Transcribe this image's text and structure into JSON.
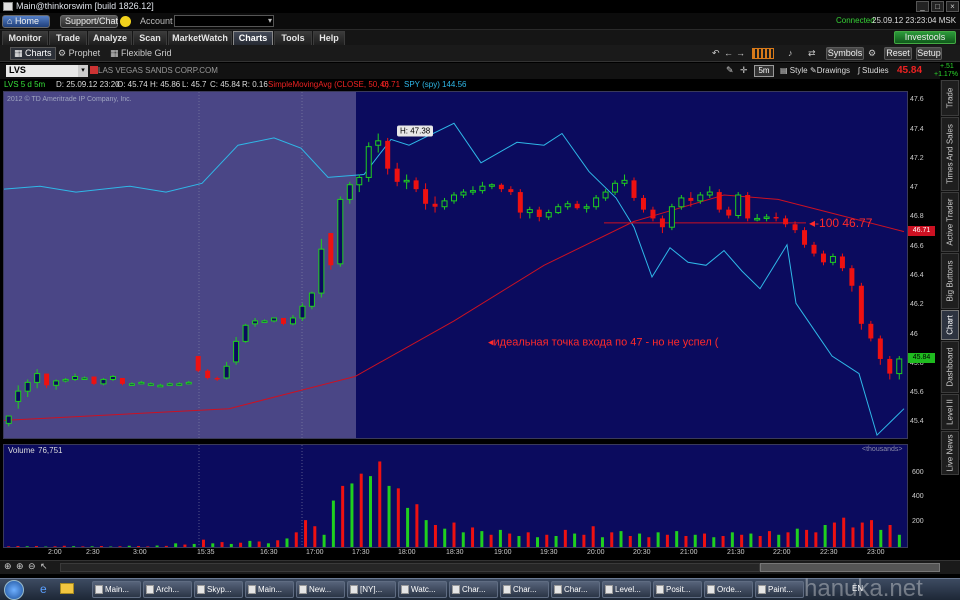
{
  "window": {
    "title": "Main@thinkorswim [build 1826.12]"
  },
  "account_bar": {
    "home": "Home",
    "support": "Support/Chat",
    "account_label": "Account",
    "connected": "Connected",
    "datetime": "25.09.12 23:23:04 MSK"
  },
  "main_tabs": [
    "Monitor",
    "Trade",
    "Analyze",
    "Scan",
    "MarketWatch",
    "Charts",
    "Tools",
    "Help"
  ],
  "active_tab": "Charts",
  "investools": "Investools",
  "subtabs": [
    "Charts",
    "Prophet",
    "Flexible Grid"
  ],
  "toolbar": {
    "symbols": "Symbols",
    "reset": "Reset",
    "setup": "Setup"
  },
  "symbol_bar": {
    "symbol": "LVS",
    "company": "LAS VEGAS SANDS CORP.COM",
    "period": "5m",
    "style": "Style",
    "drawings": "Drawings",
    "studies": "Studies",
    "last": "45.84",
    "change": "+.51",
    "change_pct": "+1.17%"
  },
  "info": {
    "symbol_period": "LVS 5 d 5m",
    "date": "D: 25.09.12 23:20",
    "open": "O: 45.74",
    "high": "H: 45.86",
    "low": "L: 45.7",
    "close": "C: 45.84",
    "range": "R: 0.16",
    "study": "SimpleMovingAvg (CLOSE, 50, 0)",
    "study_value": "46.71",
    "compare": "SPY (spy)",
    "compare_value": "144.56"
  },
  "copyright": "2012 © TD Ameritrade IP Company, Inc.",
  "annotations": {
    "high": "H: 47.38",
    "level": "-100 46.77",
    "entry": "идеальная точка входа по 47 - но не успел ("
  },
  "y_ticks": [
    "47.6",
    "47.4",
    "47.2",
    "47",
    "46.8",
    "46.6",
    "46.4",
    "46.2",
    "46",
    "45.8",
    "45.6",
    "45.4"
  ],
  "price_badges": {
    "sma": "46.71",
    "last": "45.84"
  },
  "volume": {
    "label": "Volume",
    "value": "76,751",
    "unit": "<thousands>",
    "ticks": [
      "600",
      "400",
      "200"
    ]
  },
  "x_ticks": [
    "2:00",
    "2:30",
    "3:00",
    "15:35",
    "16:30",
    "17:00",
    "17:30",
    "18:00",
    "18:30",
    "19:00",
    "19:30",
    "20:00",
    "20:30",
    "21:00",
    "21:30",
    "22:00",
    "22:30",
    "23:00"
  ],
  "side_tabs": [
    "Trade",
    "Times And Sales",
    "Active Trader",
    "Big Buttons",
    "Chart",
    "Dashboard",
    "Level II",
    "Live News"
  ],
  "active_side_tab": "Chart",
  "taskbar": {
    "items": [
      "Main...",
      "Arch...",
      "Skyp...",
      "Main...",
      "New...",
      "[NY]...",
      "Watc...",
      "Char...",
      "Char...",
      "Char...",
      "Level...",
      "Posit...",
      "Orde...",
      "Paint..."
    ],
    "lang": "EN",
    "watermark": "hanuka.net"
  },
  "colors": {
    "up": "#1fcf1f",
    "down": "#ee1111",
    "sma": "#cc1122",
    "spy": "#2fb8e8",
    "bg": "#0b0b5e",
    "premarket": "#4a4686",
    "annotation": "#ff2a2a"
  },
  "chart_data": {
    "type": "candlestick",
    "symbol": "LVS",
    "interval": "5m",
    "ylim": [
      45.3,
      47.65
    ],
    "x_tick_labels": [
      "2:00",
      "2:30",
      "3:00",
      "15:35",
      "16:30",
      "17:00",
      "17:30",
      "18:00",
      "18:30",
      "19:00",
      "19:30",
      "20:00",
      "20:30",
      "21:00",
      "21:30",
      "22:00",
      "22:30",
      "23:00"
    ],
    "candles": [
      [
        45.4,
        45.45,
        45.38,
        45.45,
        0
      ],
      [
        45.55,
        45.66,
        45.5,
        45.62,
        0
      ],
      [
        45.62,
        45.7,
        45.58,
        45.68,
        0
      ],
      [
        45.68,
        45.77,
        45.64,
        45.74,
        0
      ],
      [
        45.74,
        45.74,
        45.64,
        45.66,
        0
      ],
      [
        45.66,
        45.7,
        45.63,
        45.69,
        0
      ],
      [
        45.69,
        45.71,
        45.68,
        45.7,
        0
      ],
      [
        45.7,
        45.74,
        45.69,
        45.72,
        0
      ],
      [
        45.71,
        45.72,
        45.7,
        45.71,
        0
      ],
      [
        45.72,
        45.72,
        45.66,
        45.67,
        0
      ],
      [
        45.67,
        45.71,
        45.66,
        45.7,
        0
      ],
      [
        45.7,
        45.73,
        45.69,
        45.72,
        0
      ],
      [
        45.71,
        45.71,
        45.66,
        45.67,
        0
      ],
      [
        45.67,
        45.68,
        45.66,
        45.67,
        0
      ],
      [
        45.68,
        45.69,
        45.67,
        45.68,
        0
      ],
      [
        45.67,
        45.68,
        45.66,
        45.67,
        0
      ],
      [
        45.66,
        45.67,
        45.65,
        45.66,
        0
      ],
      [
        45.67,
        45.68,
        45.66,
        45.67,
        0
      ],
      [
        45.67,
        45.68,
        45.66,
        45.67,
        0
      ],
      [
        45.68,
        45.69,
        45.67,
        45.68,
        0
      ],
      [
        45.86,
        45.86,
        45.75,
        45.76,
        0
      ],
      [
        45.76,
        45.77,
        45.7,
        45.71,
        0
      ],
      [
        45.71,
        45.72,
        45.69,
        45.7,
        0
      ],
      [
        45.71,
        45.82,
        45.7,
        45.79,
        0
      ],
      [
        45.82,
        45.99,
        45.8,
        45.96,
        0
      ],
      [
        45.96,
        46.08,
        45.95,
        46.07,
        0
      ],
      [
        46.08,
        46.12,
        46.06,
        46.1,
        0
      ],
      [
        46.1,
        46.11,
        46.09,
        46.1,
        0
      ],
      [
        46.1,
        46.12,
        46.09,
        46.12,
        0
      ],
      [
        46.12,
        46.12,
        46.07,
        46.08,
        0
      ],
      [
        46.08,
        46.14,
        46.07,
        46.12,
        0
      ],
      [
        46.12,
        46.22,
        46.1,
        46.2,
        0
      ],
      [
        46.2,
        46.3,
        46.18,
        46.29,
        0
      ],
      [
        46.29,
        46.66,
        46.26,
        46.59,
        0
      ],
      [
        46.7,
        46.7,
        46.45,
        46.48,
        0
      ],
      [
        46.49,
        46.95,
        46.47,
        46.93,
        0
      ],
      [
        46.93,
        47.05,
        46.9,
        47.03,
        0
      ],
      [
        47.03,
        47.1,
        46.98,
        47.08,
        0
      ],
      [
        47.08,
        47.32,
        47.05,
        47.29,
        0
      ],
      [
        47.3,
        47.38,
        47.25,
        47.33,
        0
      ],
      [
        47.33,
        47.35,
        47.1,
        47.14,
        0
      ],
      [
        47.14,
        47.18,
        47.02,
        47.05,
        0
      ],
      [
        47.05,
        47.1,
        47.0,
        47.06,
        0
      ],
      [
        47.06,
        47.08,
        46.98,
        47.0,
        0
      ],
      [
        47.0,
        47.04,
        46.86,
        46.9,
        0
      ],
      [
        46.9,
        46.95,
        46.84,
        46.88,
        0
      ],
      [
        46.88,
        46.94,
        46.86,
        46.92,
        0
      ],
      [
        46.92,
        46.98,
        46.9,
        46.96,
        0
      ],
      [
        46.96,
        47.0,
        46.94,
        46.98,
        0
      ],
      [
        46.98,
        47.02,
        46.96,
        46.99,
        0
      ],
      [
        46.99,
        47.05,
        46.97,
        47.02,
        0
      ],
      [
        47.02,
        47.04,
        47.0,
        47.03,
        0
      ],
      [
        47.03,
        47.04,
        46.98,
        47.0,
        0
      ],
      [
        47.0,
        47.02,
        46.96,
        46.98,
        0
      ],
      [
        46.98,
        47.0,
        46.8,
        46.84,
        0
      ],
      [
        46.84,
        46.88,
        46.8,
        46.86,
        0
      ],
      [
        46.86,
        46.88,
        46.78,
        46.81,
        0
      ],
      [
        46.81,
        46.86,
        46.79,
        46.84,
        0
      ],
      [
        46.84,
        46.9,
        46.83,
        46.88,
        0
      ],
      [
        46.88,
        46.92,
        46.86,
        46.9,
        0
      ],
      [
        46.9,
        46.92,
        46.86,
        46.87,
        0
      ],
      [
        46.87,
        46.9,
        46.84,
        46.88,
        0
      ],
      [
        46.88,
        46.96,
        46.86,
        46.94,
        0
      ],
      [
        46.94,
        47.0,
        46.92,
        46.98,
        0
      ],
      [
        46.98,
        47.06,
        46.96,
        47.04,
        0
      ],
      [
        47.04,
        47.1,
        47.02,
        47.06,
        0
      ],
      [
        47.06,
        47.08,
        46.92,
        46.94,
        0
      ],
      [
        46.94,
        46.96,
        46.84,
        46.86,
        0
      ],
      [
        46.86,
        46.88,
        46.78,
        46.8,
        0
      ],
      [
        46.8,
        46.82,
        46.7,
        46.74,
        0
      ],
      [
        46.74,
        46.9,
        46.72,
        46.88,
        0
      ],
      [
        46.88,
        46.96,
        46.86,
        46.94,
        0
      ],
      [
        46.94,
        46.98,
        46.88,
        46.92,
        0
      ],
      [
        46.92,
        46.98,
        46.9,
        46.96,
        0
      ],
      [
        46.96,
        47.02,
        46.94,
        46.98,
        0
      ],
      [
        46.98,
        47.0,
        46.84,
        46.86,
        0
      ],
      [
        46.86,
        46.88,
        46.8,
        46.82,
        0
      ],
      [
        46.82,
        46.98,
        46.8,
        46.96,
        0
      ],
      [
        46.96,
        46.98,
        46.78,
        46.8,
        0
      ],
      [
        46.8,
        46.83,
        46.78,
        46.8,
        0
      ],
      [
        46.8,
        46.83,
        46.78,
        46.81,
        0
      ],
      [
        46.81,
        46.84,
        46.78,
        46.8,
        0
      ],
      [
        46.8,
        46.82,
        46.74,
        46.76,
        0
      ],
      [
        46.76,
        46.78,
        46.7,
        46.72,
        0
      ],
      [
        46.72,
        46.74,
        46.6,
        46.62,
        0
      ],
      [
        46.62,
        46.64,
        46.54,
        46.56,
        0
      ],
      [
        46.56,
        46.58,
        46.48,
        46.5,
        0
      ],
      [
        46.5,
        46.56,
        46.48,
        46.54,
        0
      ],
      [
        46.54,
        46.56,
        46.44,
        46.46,
        0
      ],
      [
        46.46,
        46.48,
        46.3,
        46.34,
        0
      ],
      [
        46.34,
        46.36,
        46.04,
        46.08,
        0
      ],
      [
        46.08,
        46.1,
        45.96,
        45.98,
        0
      ],
      [
        45.98,
        46.0,
        45.8,
        45.84,
        0
      ],
      [
        45.84,
        45.86,
        45.7,
        45.74,
        0
      ],
      [
        45.74,
        45.86,
        45.7,
        45.84,
        0
      ]
    ],
    "volume_ylim": [
      0,
      720
    ],
    "volume": [
      [
        5,
        0
      ],
      [
        8,
        0
      ],
      [
        6,
        1
      ],
      [
        8,
        0
      ],
      [
        4,
        1
      ],
      [
        6,
        0
      ],
      [
        10,
        0
      ],
      [
        7,
        1
      ],
      [
        5,
        0
      ],
      [
        6,
        1
      ],
      [
        8,
        0
      ],
      [
        4,
        1
      ],
      [
        6,
        0
      ],
      [
        10,
        1
      ],
      [
        8,
        0
      ],
      [
        5,
        0
      ],
      [
        12,
        1
      ],
      [
        9,
        0
      ],
      [
        30,
        1
      ],
      [
        20,
        0
      ],
      [
        25,
        1
      ],
      [
        60,
        0
      ],
      [
        30,
        1
      ],
      [
        40,
        0
      ],
      [
        25,
        1
      ],
      [
        35,
        0
      ],
      [
        50,
        1
      ],
      [
        45,
        0
      ],
      [
        30,
        1
      ],
      [
        55,
        0
      ],
      [
        70,
        1
      ],
      [
        120,
        0
      ],
      [
        220,
        0
      ],
      [
        170,
        0
      ],
      [
        100,
        1
      ],
      [
        380,
        1
      ],
      [
        500,
        0
      ],
      [
        520,
        1
      ],
      [
        600,
        0
      ],
      [
        580,
        1
      ],
      [
        700,
        0
      ],
      [
        500,
        1
      ],
      [
        480,
        0
      ],
      [
        320,
        1
      ],
      [
        350,
        0
      ],
      [
        220,
        1
      ],
      [
        180,
        0
      ],
      [
        150,
        1
      ],
      [
        200,
        0
      ],
      [
        120,
        1
      ],
      [
        160,
        0
      ],
      [
        130,
        1
      ],
      [
        100,
        0
      ],
      [
        140,
        1
      ],
      [
        110,
        0
      ],
      [
        90,
        1
      ],
      [
        120,
        0
      ],
      [
        80,
        1
      ],
      [
        100,
        0
      ],
      [
        90,
        1
      ],
      [
        140,
        0
      ],
      [
        110,
        1
      ],
      [
        100,
        0
      ],
      [
        170,
        0
      ],
      [
        80,
        1
      ],
      [
        120,
        0
      ],
      [
        130,
        1
      ],
      [
        90,
        0
      ],
      [
        110,
        1
      ],
      [
        80,
        0
      ],
      [
        120,
        1
      ],
      [
        100,
        0
      ],
      [
        130,
        1
      ],
      [
        90,
        0
      ],
      [
        100,
        1
      ],
      [
        110,
        0
      ],
      [
        80,
        1
      ],
      [
        90,
        0
      ],
      [
        120,
        1
      ],
      [
        100,
        0
      ],
      [
        110,
        1
      ],
      [
        90,
        0
      ],
      [
        130,
        0
      ],
      [
        100,
        1
      ],
      [
        120,
        0
      ],
      [
        150,
        1
      ],
      [
        140,
        0
      ],
      [
        120,
        0
      ],
      [
        180,
        1
      ],
      [
        200,
        0
      ],
      [
        240,
        0
      ],
      [
        160,
        0
      ],
      [
        200,
        0
      ],
      [
        220,
        0
      ],
      [
        140,
        1
      ],
      [
        180,
        0
      ],
      [
        100,
        1
      ]
    ],
    "sma": [
      [
        0,
        45.42
      ],
      [
        0.25,
        45.5
      ],
      [
        0.39,
        45.72
      ],
      [
        0.5,
        46.1
      ],
      [
        0.6,
        46.48
      ],
      [
        0.7,
        46.78
      ],
      [
        0.8,
        46.96
      ],
      [
        0.86,
        46.93
      ],
      [
        0.93,
        46.82
      ],
      [
        1,
        46.71
      ]
    ],
    "spy_overlay": [
      [
        0,
        47
      ],
      [
        0.04,
        47.02
      ],
      [
        0.08,
        46.98
      ],
      [
        0.14,
        47.02
      ],
      [
        0.18,
        46.98
      ],
      [
        0.22,
        47.04
      ],
      [
        0.26,
        47.3
      ],
      [
        0.3,
        47.35
      ],
      [
        0.33,
        47.28
      ],
      [
        0.36,
        47.08
      ],
      [
        0.4,
        47.1
      ],
      [
        0.43,
        47.34
      ],
      [
        0.45,
        47.3
      ],
      [
        0.5,
        47.45
      ],
      [
        0.53,
        47.18
      ],
      [
        0.57,
        47.32
      ],
      [
        0.6,
        47.3
      ],
      [
        0.62,
        47.38
      ],
      [
        0.65,
        47.12
      ],
      [
        0.68,
        46.94
      ],
      [
        0.7,
        46.74
      ],
      [
        0.72,
        46.4
      ],
      [
        0.74,
        46.6
      ],
      [
        0.76,
        46.5
      ],
      [
        0.78,
        46.48
      ],
      [
        0.8,
        46.58
      ],
      [
        0.82,
        46.44
      ],
      [
        0.84,
        46.32
      ],
      [
        0.87,
        46.62
      ],
      [
        0.88,
        46.22
      ],
      [
        0.9,
        46.04
      ],
      [
        0.92,
        45.86
      ],
      [
        0.95,
        45.74
      ],
      [
        0.97,
        45.32
      ],
      [
        1,
        45.5
      ]
    ]
  }
}
